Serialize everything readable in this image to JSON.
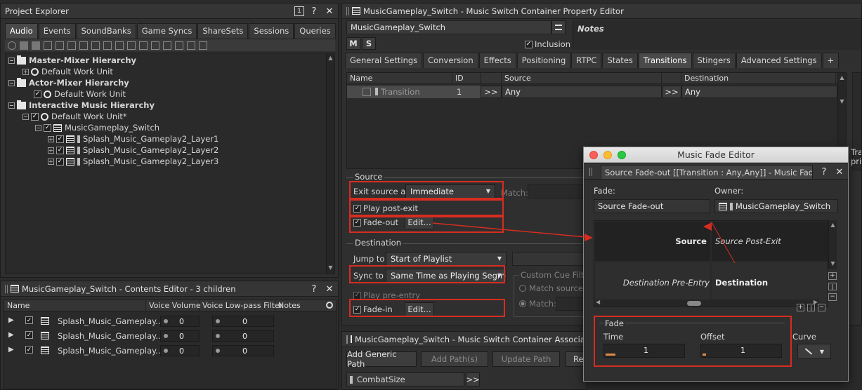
{
  "project_explorer": {
    "title": "Project Explorer",
    "tabs": [
      "Audio",
      "Events",
      "SoundBanks",
      "Game Syncs",
      "ShareSets",
      "Sessions",
      "Queries"
    ],
    "tree": [
      {
        "label": "Master-Mixer Hierarchy"
      },
      {
        "label": "Default Work Unit"
      },
      {
        "label": "Actor-Mixer Hierarchy"
      },
      {
        "label": "Default Work Unit"
      },
      {
        "label": "Interactive Music Hierarchy"
      },
      {
        "label": "Default Work Unit*"
      },
      {
        "label": "MusicGameplay_Switch"
      },
      {
        "label": "Splash_Music_Gameplay2_Layer1"
      },
      {
        "label": "Splash_Music_Gameplay2_Layer2"
      },
      {
        "label": "Splash_Music_Gameplay2_Layer3"
      }
    ]
  },
  "contents_editor": {
    "title": "MusicGameplay_Switch - Contents Editor - 3 children",
    "columns": [
      "Name",
      "Voice Volume",
      "Voice Low-pass Filter",
      "Notes"
    ],
    "rows": [
      {
        "name": "Splash_Music_Gameplay...",
        "volume": "0",
        "lpf": "0"
      },
      {
        "name": "Splash_Music_Gameplay...",
        "volume": "0",
        "lpf": "0"
      },
      {
        "name": "Splash_Music_Gameplay...",
        "volume": "0",
        "lpf": "0"
      }
    ]
  },
  "property_editor": {
    "title": "MusicGameplay_Switch - Music Switch Container Property Editor",
    "name_value": "MusicGameplay_Switch",
    "m_label": "M",
    "s_label": "S",
    "inclusion_label": "Inclusion",
    "notes_label": "Notes",
    "tabs": [
      "General Settings",
      "Conversion",
      "Effects",
      "Positioning",
      "RTPC",
      "States",
      "Transitions",
      "Stingers",
      "Advanced Settings",
      "+"
    ],
    "transition_table": {
      "columns": [
        "Name",
        "ID",
        "Source",
        "Destination"
      ],
      "row": {
        "name": "Transition",
        "id": "1",
        "source": "Any",
        "destination": "Any",
        "arrow": ">>"
      }
    },
    "source": {
      "group_label": "Source",
      "exit_source_label": "Exit source at",
      "exit_source_value": "Immediate",
      "match_label": "Match:",
      "play_post_exit_label": "Play post-exit",
      "fade_out_label": "Fade-out",
      "edit_label": "Edit..."
    },
    "destination": {
      "group_label": "Destination",
      "jump_to_label": "Jump to",
      "jump_to_value": "Start of Playlist",
      "sync_to_label": "Sync to",
      "sync_to_value": "Same Time as Playing Segment",
      "custom_cue_label": "Custom Cue Filter",
      "match_source_label": "Match source cu",
      "match_label": "Match:",
      "play_pre_entry_label": "Play pre-entry",
      "fade_in_label": "Fade-in",
      "edit_label": "Edit..."
    },
    "side_text_1": "Tra",
    "side_text_2": "pric"
  },
  "association_editor": {
    "title": "MusicGameplay_Switch - Music Switch Container Association Editor",
    "add_generic_path": "Add Generic Path",
    "add_paths": "Add Path(s)",
    "update_path": "Update Path",
    "re_label": "Re",
    "combat_size": "CombatSize",
    "arrow": ">>"
  },
  "fade_editor": {
    "window_title": "Music Fade Editor",
    "subtitle": "Source Fade-out [[Transition : Any,Any]] - Music Fade Edi...",
    "fade_label": "Fade:",
    "fade_value": "Source Fade-out",
    "owner_label": "Owner:",
    "owner_value": "MusicGameplay_Switch",
    "graph": {
      "source": "Source",
      "source_post_exit": "Source Post-Exit",
      "destination_pre_entry": "Destination Pre-Entry",
      "destination": "Destination"
    },
    "fade_group": "Fade",
    "time_label": "Time",
    "time_value": "1",
    "offset_label": "Offset",
    "offset_value": "1",
    "curve_label": "Curve"
  },
  "colors": {
    "annotation_red": "#d62d20",
    "panel_bg": "#2f2f2f",
    "active_tab": "#4a4a4a"
  }
}
